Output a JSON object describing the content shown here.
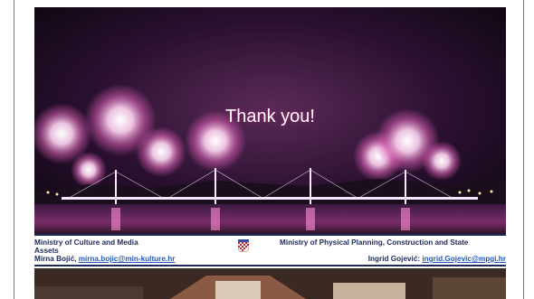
{
  "slide": {
    "title": "Thank you!"
  },
  "footer": {
    "left_org_line1": "Ministry of Culture and Media",
    "left_org_line2": "Assets",
    "left_contact_name": "Mirna Bojić,",
    "left_contact_email": "mirna.bojic@min-kulture.hr",
    "right_org": "Ministry of Physical Planning, Construction and State",
    "right_contact_name": "Ingrid Gojević:",
    "right_contact_email": "ingrid.Gojevic@mpgi.hr"
  },
  "colors": {
    "footer_text": "#1c2a5c",
    "link": "#2358b8",
    "firework": "#f3a8e0"
  }
}
